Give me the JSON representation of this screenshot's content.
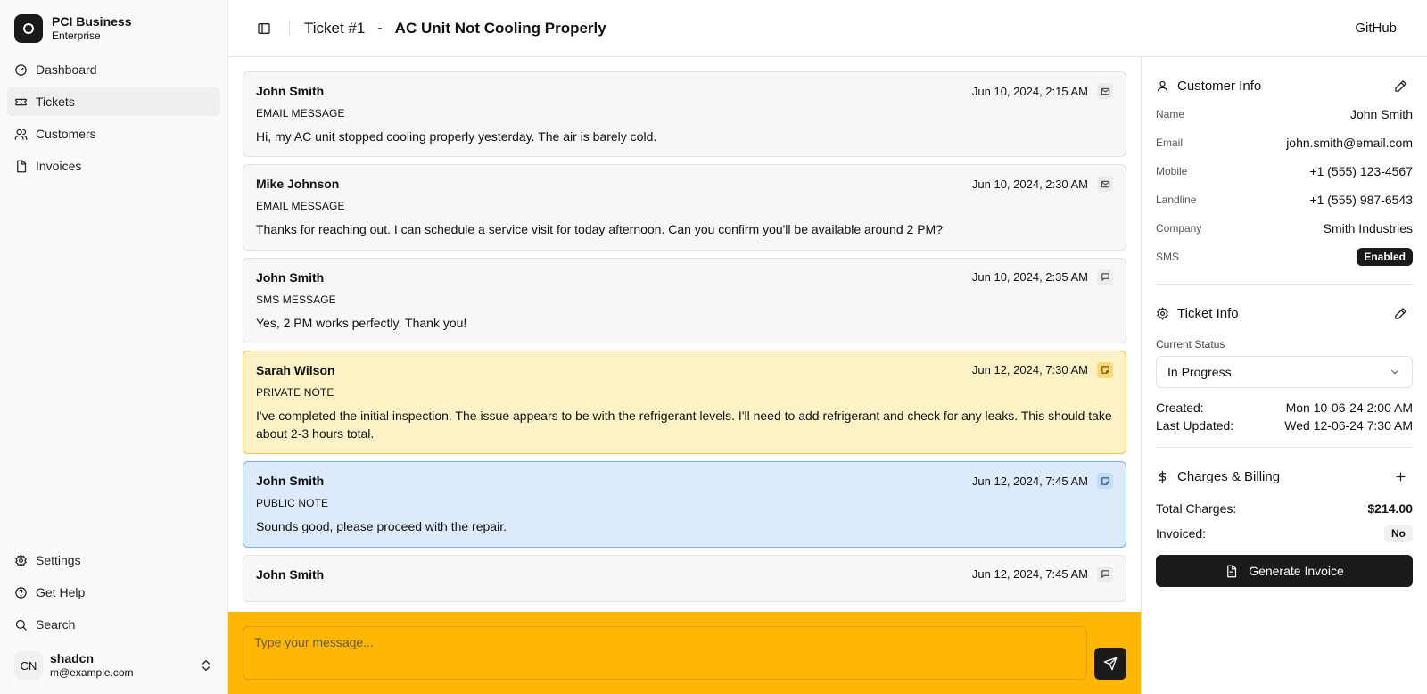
{
  "brand": {
    "name": "PCI Business",
    "plan": "Enterprise"
  },
  "nav": {
    "items": [
      {
        "label": "Dashboard",
        "icon": "gauge-icon"
      },
      {
        "label": "Tickets",
        "icon": "ticket-icon",
        "active": true
      },
      {
        "label": "Customers",
        "icon": "users-icon"
      },
      {
        "label": "Invoices",
        "icon": "file-icon"
      }
    ],
    "footer": [
      {
        "label": "Settings",
        "icon": "gear-icon"
      },
      {
        "label": "Get Help",
        "icon": "help-icon"
      },
      {
        "label": "Search",
        "icon": "search-icon"
      }
    ]
  },
  "user": {
    "initials": "CN",
    "name": "shadcn",
    "email": "m@example.com"
  },
  "header": {
    "ticket_number": "Ticket #1",
    "separator": "-",
    "ticket_title": "AC Unit Not Cooling Properly",
    "github": "GitHub"
  },
  "messages": [
    {
      "author": "John Smith",
      "time": "Jun 10, 2024, 2:15 AM",
      "type": "EMAIL MESSAGE",
      "body": "Hi, my AC unit stopped cooling properly yesterday. The air is barely cold.",
      "kind": "email"
    },
    {
      "author": "Mike Johnson",
      "time": "Jun 10, 2024, 2:30 AM",
      "type": "EMAIL MESSAGE",
      "body": "Thanks for reaching out. I can schedule a service visit for today afternoon. Can you confirm you'll be available around 2 PM?",
      "kind": "email"
    },
    {
      "author": "John Smith",
      "time": "Jun 10, 2024, 2:35 AM",
      "type": "SMS MESSAGE",
      "body": "Yes, 2 PM works perfectly. Thank you!",
      "kind": "sms"
    },
    {
      "author": "Sarah Wilson",
      "time": "Jun 12, 2024, 7:30 AM",
      "type": "PRIVATE NOTE",
      "body": "I've completed the initial inspection. The issue appears to be with the refrigerant levels. I'll need to add refrigerant and check for any leaks. This should take about 2-3 hours total.",
      "kind": "private"
    },
    {
      "author": "John Smith",
      "time": "Jun 12, 2024, 7:45 AM",
      "type": "PUBLIC NOTE",
      "body": "Sounds good, please proceed with the repair.",
      "kind": "public"
    },
    {
      "author": "John Smith",
      "time": "Jun 12, 2024, 7:45 AM",
      "type": "",
      "body": "",
      "kind": "sms"
    }
  ],
  "composer": {
    "placeholder": "Type your message..."
  },
  "customer": {
    "title": "Customer Info",
    "fields": [
      {
        "label": "Name",
        "value": "John Smith"
      },
      {
        "label": "Email",
        "value": "john.smith@email.com"
      },
      {
        "label": "Mobile",
        "value": "+1 (555) 123-4567"
      },
      {
        "label": "Landline",
        "value": "+1 (555) 987-6543"
      },
      {
        "label": "Company",
        "value": "Smith Industries"
      }
    ],
    "sms_label": "SMS",
    "sms_value": "Enabled"
  },
  "ticket_info": {
    "title": "Ticket Info",
    "status_label": "Current Status",
    "status_value": "In Progress",
    "created_label": "Created:",
    "created_value": "Mon 10-06-24 2:00 AM",
    "updated_label": "Last Updated:",
    "updated_value": "Wed 12-06-24 7:30 AM"
  },
  "billing": {
    "title": "Charges & Billing",
    "total_label": "Total Charges:",
    "total_value": "$214.00",
    "invoiced_label": "Invoiced:",
    "invoiced_value": "No",
    "button": "Generate Invoice"
  },
  "colors": {
    "composer_bg": "#ffb703",
    "private_bg": "#fdf2c6",
    "public_bg": "#dceafc",
    "dark": "#1a1a1a"
  }
}
